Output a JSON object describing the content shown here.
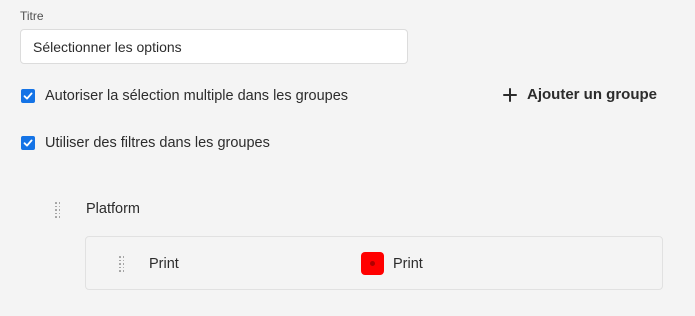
{
  "title_field": {
    "label": "Titre",
    "value": "Sélectionner les options"
  },
  "options": {
    "multi_select": {
      "label": "Autoriser la sélection multiple dans les groupes",
      "checked": true
    },
    "use_filters": {
      "label": "Utiliser des filtres dans les groupes",
      "checked": true
    }
  },
  "actions": {
    "add_group_label": "Ajouter un groupe",
    "add_group_icon": "plus-icon"
  },
  "groups": [
    {
      "title": "Platform",
      "items": [
        {
          "label": "Print",
          "value": "Print",
          "color": "#ff0000"
        }
      ]
    }
  ],
  "colors": {
    "accent": "#1473e6",
    "background": "#f4f4f4"
  }
}
